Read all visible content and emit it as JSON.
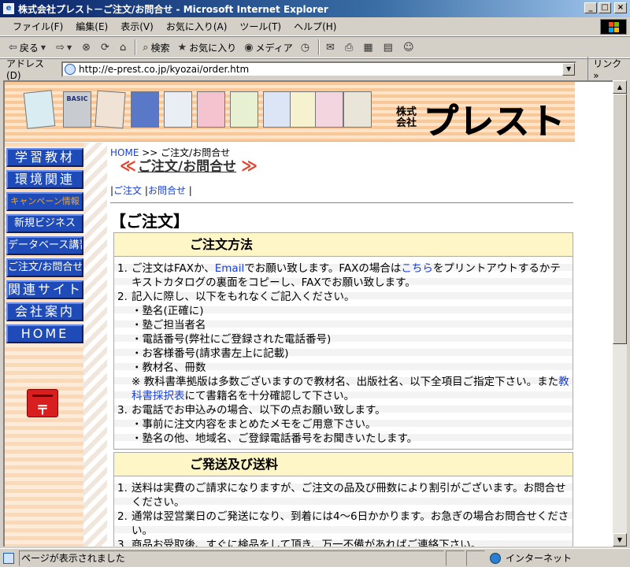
{
  "window": {
    "title": "株式会社プレスト－ご注文/お問合せ - Microsoft Internet Explorer",
    "controls": [
      "_",
      "□",
      "×"
    ]
  },
  "menubar": [
    "ファイル(F)",
    "編集(E)",
    "表示(V)",
    "お気に入り(A)",
    "ツール(T)",
    "ヘルプ(H)"
  ],
  "toolbar": {
    "back": "戻る",
    "search": "検索",
    "favorites": "お気に入り",
    "media": "メディア"
  },
  "address": {
    "label": "アドレス(D)",
    "url": "http://e-prest.co.jp/kyozai/order.htm",
    "links": "リンク"
  },
  "banner": {
    "brand_small": "株式会社",
    "brand_name": "プレスト",
    "books": [
      "",
      "BASIC",
      "",
      "",
      "",
      "",
      "",
      "",
      "",
      "",
      ""
    ]
  },
  "nav": [
    {
      "label": "学習教材",
      "style": "normal"
    },
    {
      "label": "環境関連",
      "style": "normal"
    },
    {
      "label": "キャンペーン情報",
      "style": "campaign"
    },
    {
      "label": "新規ビジネス",
      "style": "small"
    },
    {
      "label": "データベース講習",
      "style": "small"
    },
    {
      "label": "ご注文/お問合せ",
      "style": "small"
    },
    {
      "label": "関連サイト",
      "style": "normal"
    },
    {
      "label": "会社案内",
      "style": "normal"
    },
    {
      "label": "HOME",
      "style": "normal"
    }
  ],
  "mailbox_mark": "〒",
  "breadcrumb": {
    "home": "HOME",
    "sep": " >> ",
    "current": "ご注文/お問合せ"
  },
  "page_heading": {
    "left_arrow": "≪",
    "text": "ご注文/お問合せ",
    "right_arrow": "≫"
  },
  "sublinks": {
    "order": "ご注文",
    "inquiry": "お問合せ",
    "divider": "|"
  },
  "section_title": "【ご注文】",
  "order_method": {
    "header": "ご注文方法",
    "item1_num": "1.",
    "item1_a": "ご注文はFAXか、",
    "item1_email": "Email",
    "item1_b": "でお願い致します。FAXの場合は",
    "item1_link": "こちら",
    "item1_c": "をプリントアウトするかテキストカタログの裏面をコピーし、FAXでお願い致します。",
    "item2_num": "2.",
    "item2_text": "記入に際し、以下をもれなくご記入ください。",
    "item2_subs": [
      "・塾名(正確に)",
      "・塾ご担当者名",
      "・電話番号(弊社にご登録された電話番号)",
      "・お客様番号(請求書左上に記載)",
      "・教材名、冊数"
    ],
    "note_a": "※ 教科書準拠版は多数ございますので教材名、出版社名、以下全項目ご指定下さい。また",
    "note_link": "教科書採択表",
    "note_b": "にて書籍名を十分確認して下さい。",
    "item3_num": "3.",
    "item3_text": "お電話でお申込みの場合、以下の点お願い致します。",
    "item3_subs": [
      "・事前に注文内容をまとめたメモをご用意下さい。",
      "・塾名の他、地域名、ご登録電話番号をお聞きいたします。"
    ]
  },
  "shipping": {
    "header": "ご発送及び送料",
    "items": [
      {
        "num": "1.",
        "text": "送料は実費のご請求になりますが、ご注文の品及び冊数により割引がございます。お問合せください。"
      },
      {
        "num": "2.",
        "text": "通常は翌営業日のご発送になり、到着には4～6日かかります。お急ぎの場合お問合せください。"
      },
      {
        "num": "3.",
        "text": "商品お受取後、すぐに検品をして頂き、万一不備があればご連絡下さい。"
      }
    ]
  },
  "status": {
    "text": "ページが表示されました",
    "zone": "インターネット"
  }
}
